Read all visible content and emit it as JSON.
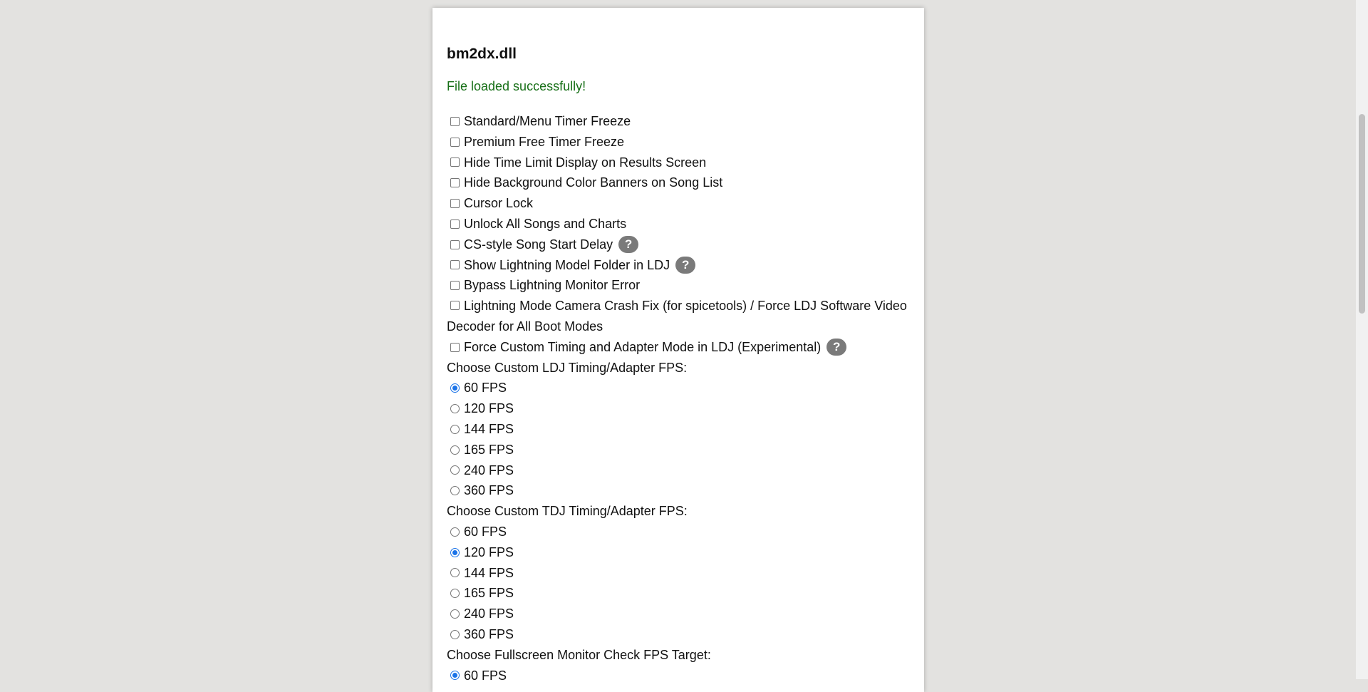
{
  "file_title": "bm2dx.dll",
  "status": "File loaded successfully!",
  "checkboxes": [
    {
      "label": "Standard/Menu Timer Freeze",
      "checked": false
    },
    {
      "label": "Premium Free Timer Freeze",
      "checked": false
    },
    {
      "label": "Hide Time Limit Display on Results Screen",
      "checked": false
    },
    {
      "label": "Hide Background Color Banners on Song List",
      "checked": false
    },
    {
      "label": "Cursor Lock",
      "checked": false
    },
    {
      "label": "Unlock All Songs and Charts",
      "checked": false
    },
    {
      "label": "CS-style Song Start Delay",
      "checked": false,
      "help": "?"
    },
    {
      "label": "Show Lightning Model Folder in LDJ",
      "checked": false,
      "help": "?"
    },
    {
      "label": "Bypass Lightning Monitor Error",
      "checked": false
    },
    {
      "label": "Lightning Mode Camera Crash Fix (for spicetools) / Force LDJ Software Video Decoder for All Boot Modes",
      "checked": false
    },
    {
      "label": "Force Custom Timing and Adapter Mode in LDJ (Experimental)",
      "checked": false,
      "help": "?"
    }
  ],
  "ldj_group": {
    "label": "Choose Custom LDJ Timing/Adapter FPS:",
    "options": [
      "60 FPS",
      "120 FPS",
      "144 FPS",
      "165 FPS",
      "240 FPS",
      "360 FPS"
    ],
    "selected": "60 FPS"
  },
  "tdj_group": {
    "label": "Choose Custom TDJ Timing/Adapter FPS:",
    "options": [
      "60 FPS",
      "120 FPS",
      "144 FPS",
      "165 FPS",
      "240 FPS",
      "360 FPS"
    ],
    "selected": "120 FPS"
  },
  "monitor_group": {
    "label": "Choose Fullscreen Monitor Check FPS Target:",
    "options": [
      "60 FPS"
    ],
    "selected": "60 FPS"
  },
  "colors": {
    "background": "#e3e2e0",
    "status_green": "#176f17",
    "radio_accent": "#1a73e8",
    "help_badge": "#7a7a7a"
  }
}
